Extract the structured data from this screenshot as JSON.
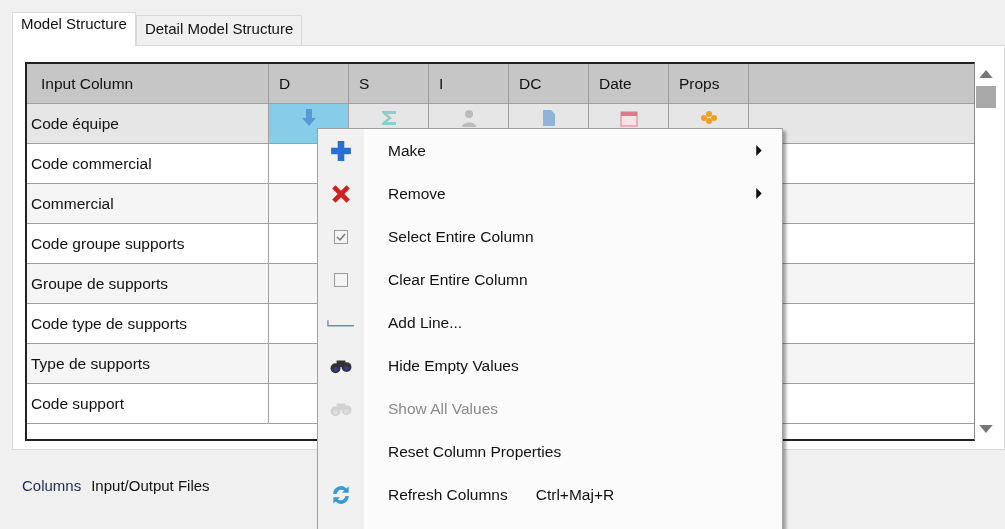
{
  "tabs": [
    {
      "label": "Model Structure",
      "selected": true
    },
    {
      "label": "Detail Model Structure",
      "selected": false
    }
  ],
  "grid": {
    "columns": [
      "Input Column",
      "D",
      "S",
      "I",
      "DC",
      "Date",
      "Props"
    ],
    "rows": [
      {
        "name": "Code équipe",
        "selected": true,
        "cells": [
          {
            "selected": true
          },
          {
            "selected": false
          },
          {
            "selected": false
          },
          {
            "selected": false
          },
          {
            "selected": false
          },
          {
            "selected": false
          }
        ]
      },
      {
        "name": "Code commercial",
        "selected": false
      },
      {
        "name": "Commercial",
        "selected": false
      },
      {
        "name": "Code groupe supports",
        "selected": false
      },
      {
        "name": "Groupe de supports",
        "selected": false
      },
      {
        "name": "Code type de supports",
        "selected": false
      },
      {
        "name": "Type de supports",
        "selected": false
      },
      {
        "name": "Code support",
        "selected": false
      }
    ]
  },
  "context_menu": [
    {
      "label": "Make",
      "submenu": true,
      "disabled": false
    },
    {
      "label": "Remove",
      "submenu": true,
      "disabled": false
    },
    {
      "label": "Select Entire Column",
      "submenu": false,
      "disabled": false
    },
    {
      "label": "Clear Entire Column",
      "submenu": false,
      "disabled": false
    },
    {
      "label": "Add Line...",
      "submenu": false,
      "disabled": false
    },
    {
      "label": "Hide Empty Values",
      "submenu": false,
      "disabled": false
    },
    {
      "label": "Show All Values",
      "submenu": false,
      "disabled": true
    },
    {
      "label": "Reset Column Properties",
      "submenu": false,
      "disabled": false
    },
    {
      "label": "Refresh Columns",
      "shortcut": "Ctrl+Maj+R",
      "submenu": false,
      "disabled": false
    }
  ],
  "bottom_tabs": [
    "Columns",
    "Input/Output Files"
  ]
}
